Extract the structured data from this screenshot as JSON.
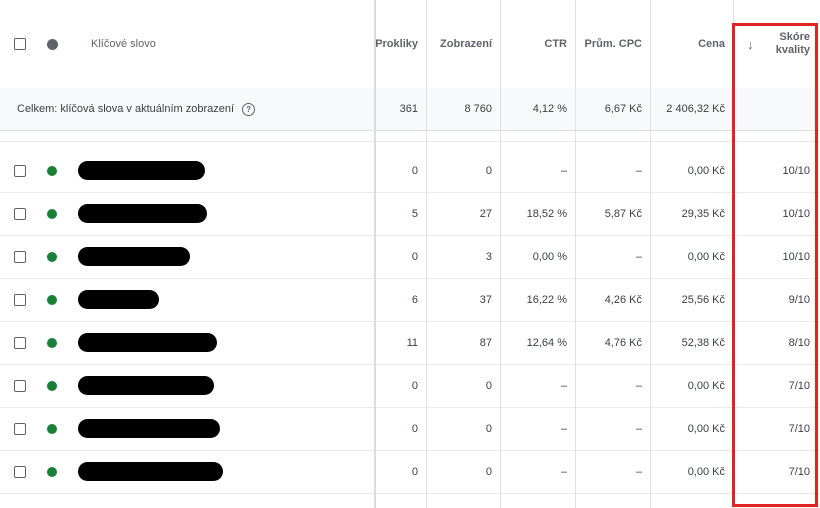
{
  "header": {
    "keyword": "Klíčové slovo",
    "clicks": "Prokliky",
    "impressions": "Zobrazení",
    "ctr": "CTR",
    "avg_cpc": "Prům. CPC",
    "cost": "Cena",
    "quality_line1": "Skóre",
    "quality_line2": "kvality",
    "sort_icon": "arrow-down-icon"
  },
  "total": {
    "label": "Celkem: klíčová slova v aktuálním zobrazení",
    "help_icon": "help-icon",
    "clicks": "361",
    "impressions": "8 760",
    "ctr": "4,12 %",
    "avg_cpc": "6,67 Kč",
    "cost": "2 406,32 Kč",
    "quality": ""
  },
  "status_color": "#188038",
  "highlight_color": "#e02424",
  "rows": [
    {
      "clicks": "0",
      "impressions": "0",
      "ctr": "–",
      "avg_cpc": "–",
      "cost": "0,00 Kč",
      "quality": "10/10"
    },
    {
      "clicks": "5",
      "impressions": "27",
      "ctr": "18,52 %",
      "avg_cpc": "5,87 Kč",
      "cost": "29,35 Kč",
      "quality": "10/10"
    },
    {
      "clicks": "0",
      "impressions": "3",
      "ctr": "0,00 %",
      "avg_cpc": "–",
      "cost": "0,00 Kč",
      "quality": "10/10"
    },
    {
      "clicks": "6",
      "impressions": "37",
      "ctr": "16,22 %",
      "avg_cpc": "4,26 Kč",
      "cost": "25,56 Kč",
      "quality": "9/10"
    },
    {
      "clicks": "11",
      "impressions": "87",
      "ctr": "12,64 %",
      "avg_cpc": "4,76 Kč",
      "cost": "52,38 Kč",
      "quality": "8/10"
    },
    {
      "clicks": "0",
      "impressions": "0",
      "ctr": "–",
      "avg_cpc": "–",
      "cost": "0,00 Kč",
      "quality": "7/10"
    },
    {
      "clicks": "0",
      "impressions": "0",
      "ctr": "–",
      "avg_cpc": "–",
      "cost": "0,00 Kč",
      "quality": "7/10"
    },
    {
      "clicks": "0",
      "impressions": "0",
      "ctr": "–",
      "avg_cpc": "–",
      "cost": "0,00 Kč",
      "quality": "7/10"
    }
  ]
}
